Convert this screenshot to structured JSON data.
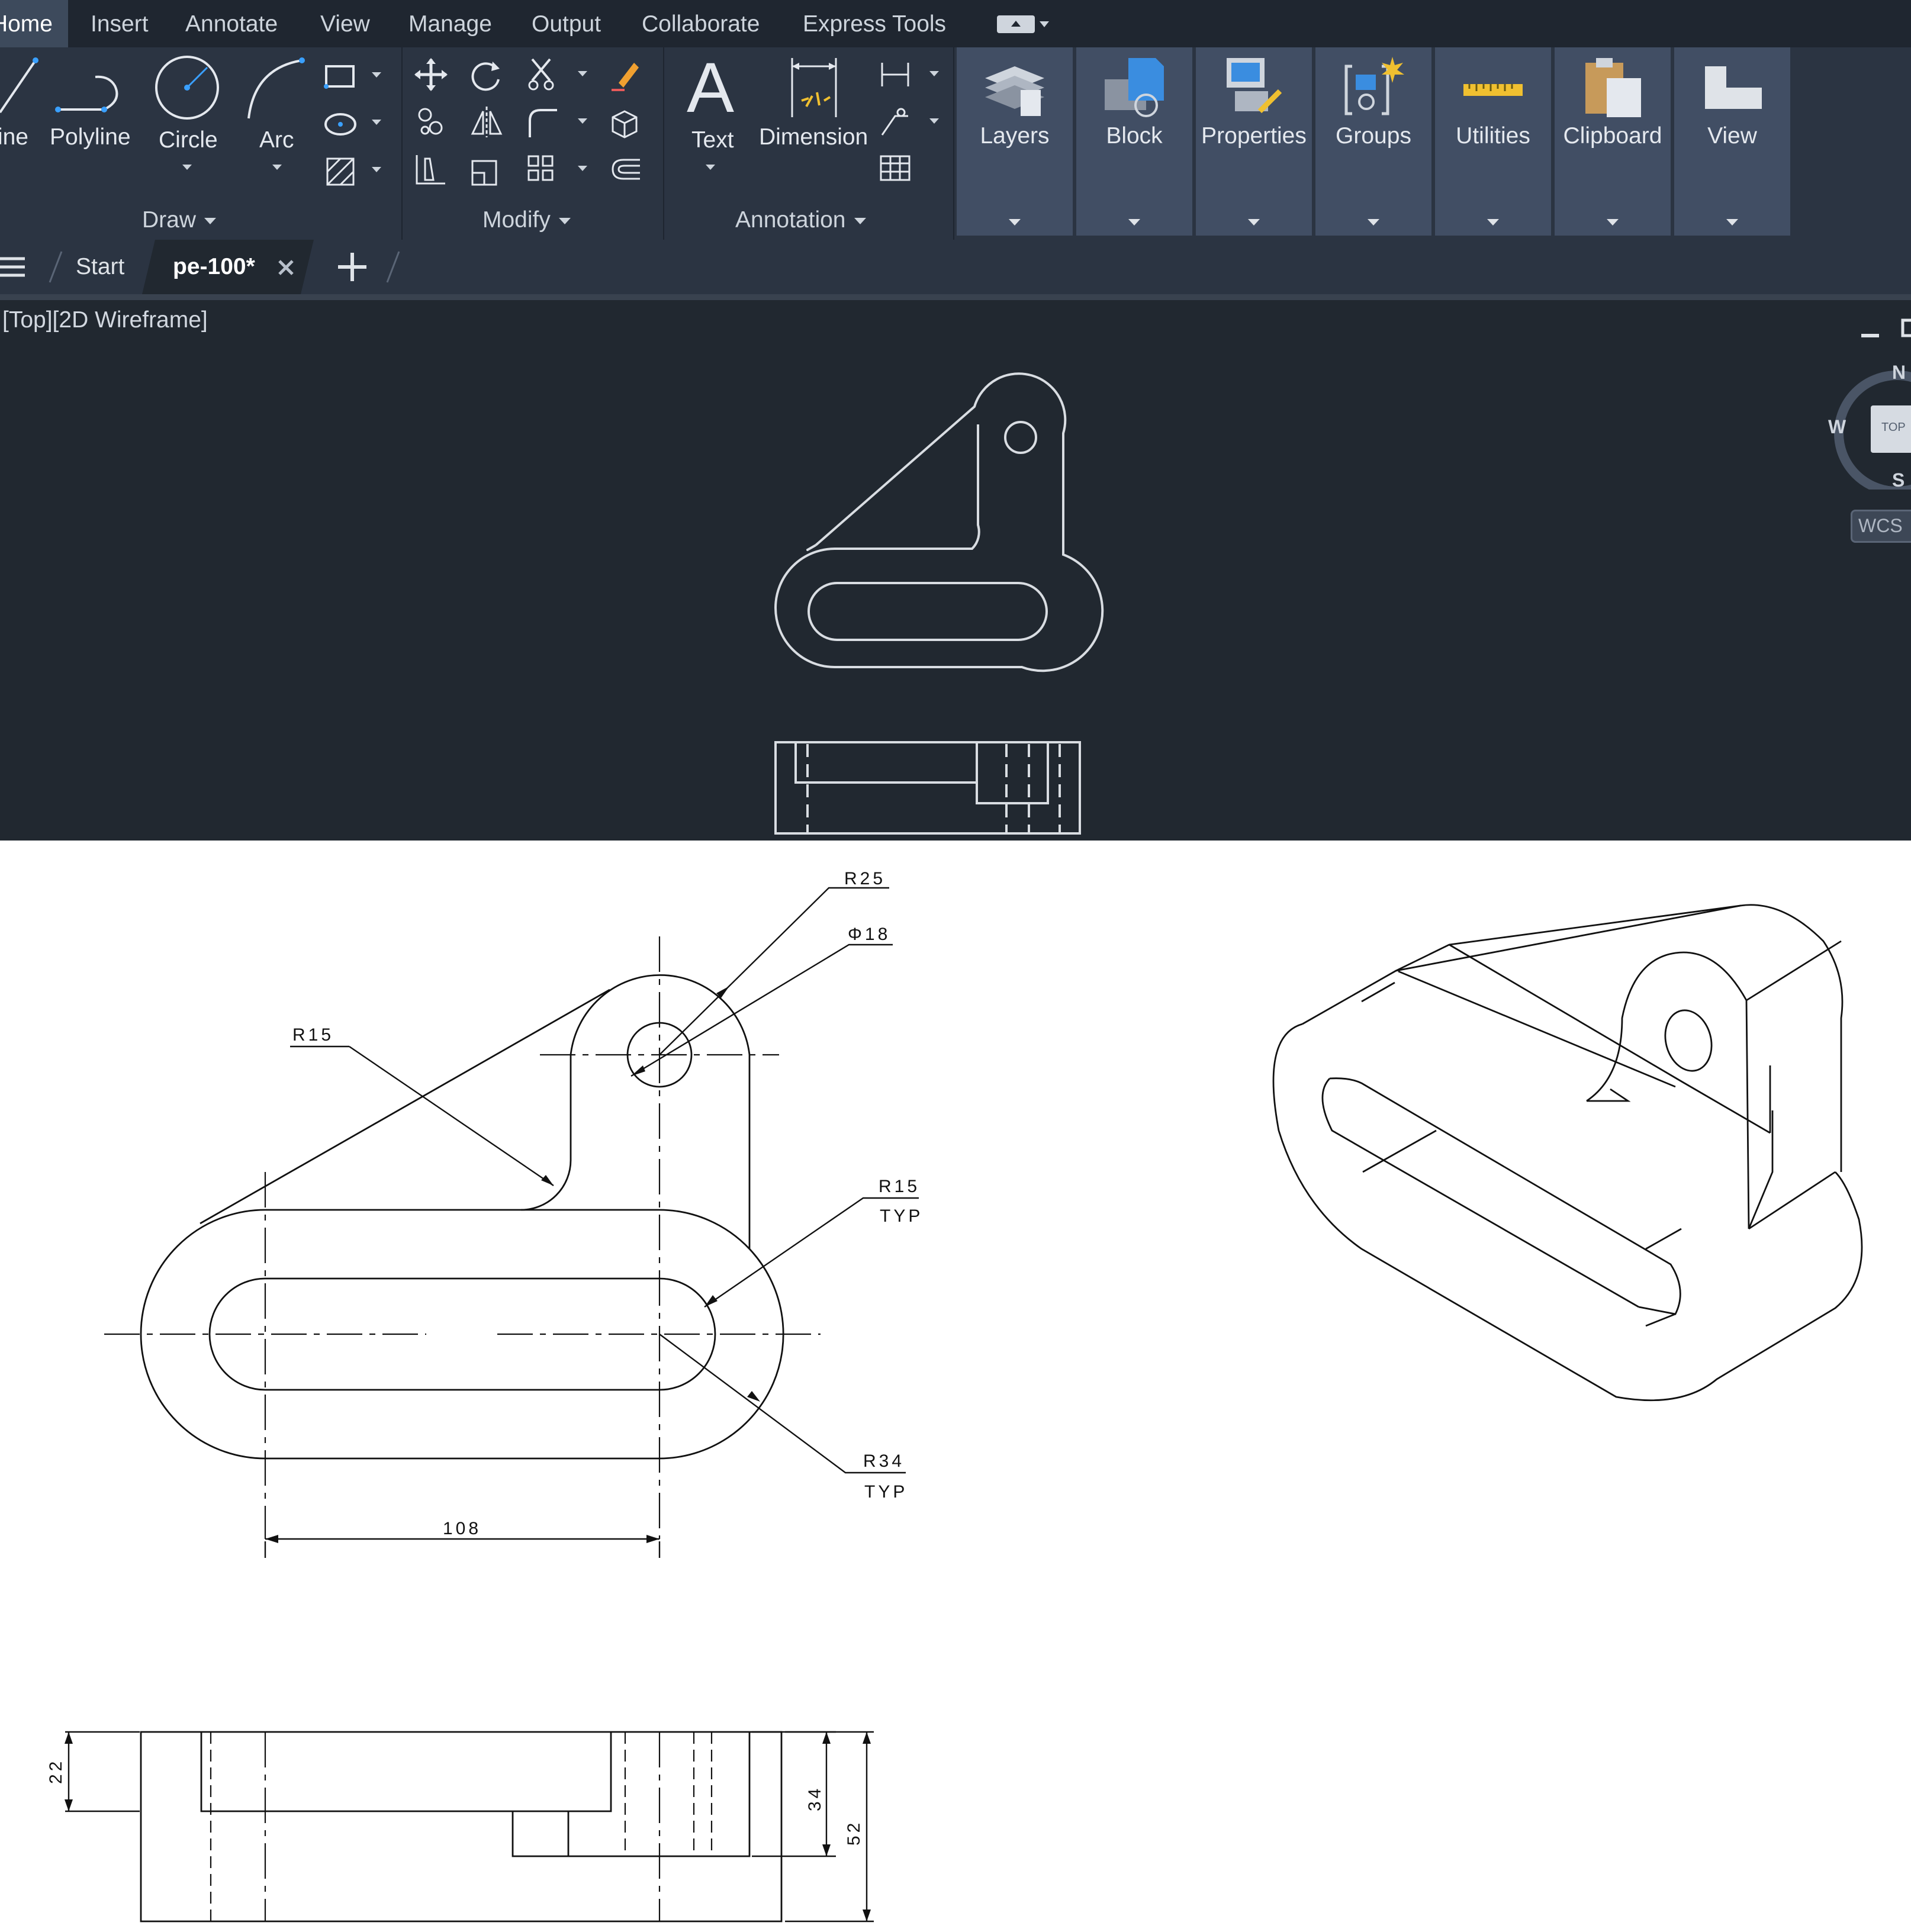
{
  "menu": {
    "tabs": [
      "Home",
      "Insert",
      "Annotate",
      "View",
      "Manage",
      "Output",
      "Collaborate",
      "Express Tools"
    ],
    "active": "Home"
  },
  "ribbon": {
    "draw": {
      "line": "Line",
      "polyline": "Polyline",
      "circle": "Circle",
      "arc": "Arc",
      "caption": "Draw"
    },
    "modify": {
      "caption": "Modify"
    },
    "annotation": {
      "text": "Text",
      "dimension": "Dimension",
      "caption": "Annotation"
    },
    "panels": [
      "Layers",
      "Block",
      "Properties",
      "Groups",
      "Utilities",
      "Clipboard",
      "View"
    ]
  },
  "file_tabs": {
    "start": "Start",
    "current": "pe-100*"
  },
  "viewport": {
    "label": "[Top][2D Wireframe]",
    "viewcube": {
      "north": "N",
      "west": "W",
      "south": "S",
      "face": "TOP",
      "wcs": "WCS"
    }
  },
  "drawing": {
    "dims": {
      "r25": "R25",
      "phi18": "Φ18",
      "r15_left": "R15",
      "r15_right": "R15",
      "typ1": "TYP",
      "r34": "R34",
      "typ2": "TYP",
      "d108": "108",
      "d22": "22",
      "d34": "34",
      "d52": "52"
    }
  },
  "colors": {
    "app_bg": "#212830",
    "ribbon_bg": "#2b3442",
    "flyout_bg": "#414e64",
    "accent_blue": "#3aa0ff",
    "drawing_line": "#d9dde2"
  }
}
